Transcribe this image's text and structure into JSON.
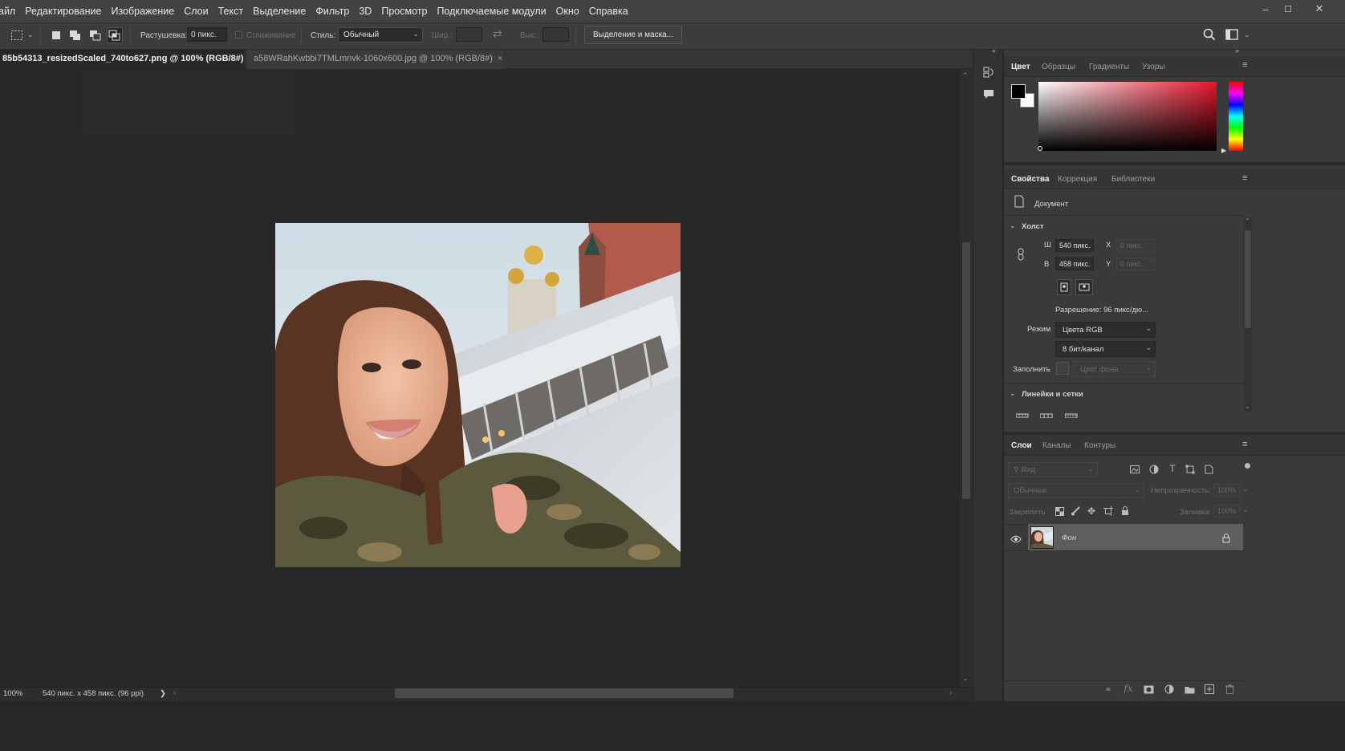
{
  "menu": [
    "айл",
    "Редактирование",
    "Изображение",
    "Слои",
    "Текст",
    "Выделение",
    "Фильтр",
    "3D",
    "Просмотр",
    "Подключаемые модули",
    "Окно",
    "Справка"
  ],
  "window_controls": {
    "minimize": "–",
    "maximize": "☐",
    "close": "✕"
  },
  "options": {
    "feather_label": "Растушевка:",
    "feather_value": "0 пикс.",
    "antialias_label": "Сглаживание",
    "style_label": "Стиль:",
    "style_value": "Обычный",
    "width_label": "Шир.:",
    "height_label": "Выс.:",
    "select_mask_button": "Выделение и маска..."
  },
  "tabs": [
    {
      "label": "85b54313_resizedScaled_740to627.png @ 100% (RGB/8#)",
      "close": "×",
      "active": true
    },
    {
      "label": "a58WRahKwbbi7TMLmnvk-1060x600.jpg @ 100% (RGB/8#)",
      "close": "×",
      "active": false
    }
  ],
  "status": {
    "zoom": "100%",
    "doc_info": "540 пикс. x 458 пикс. (96 ppi)",
    "arrow": "❯"
  },
  "color_panel": {
    "tabs": [
      "Цвет",
      "Образцы",
      "Градиенты",
      "Узоры"
    ],
    "hue_color": "#e3162a"
  },
  "properties_panel": {
    "tabs": [
      "Свойства",
      "Коррекция",
      "Библиотеки"
    ],
    "doc_label": "Документ",
    "canvas_section": "Холст",
    "w_label": "Ш",
    "w_value": "540 пикс.",
    "h_label": "В",
    "h_value": "458 пикс.",
    "x_label": "X",
    "x_value": "0 пикс.",
    "y_label": "Y",
    "y_value": "0 пикс.",
    "resolution": "Разрешение: 96 пикс/дю...",
    "mode_label": "Режим",
    "mode_value": "Цвета RGB",
    "depth_value": "8 бит/канал",
    "fill_label": "Заполнить",
    "fill_value": "Цвет фона",
    "rulers_section": "Линейки и сетки"
  },
  "layers_panel": {
    "tabs": [
      "Слои",
      "Каналы",
      "Контуры"
    ],
    "search_placeholder": "Вид",
    "blend_mode": "Обычные",
    "opacity_label": "Непрозрачность:",
    "opacity_value": "100%",
    "lock_label": "Закрепить:",
    "fill_label": "Заливка:",
    "fill_value": "100%",
    "layers": [
      {
        "name": "Фон",
        "visible": true,
        "locked": true
      }
    ]
  }
}
